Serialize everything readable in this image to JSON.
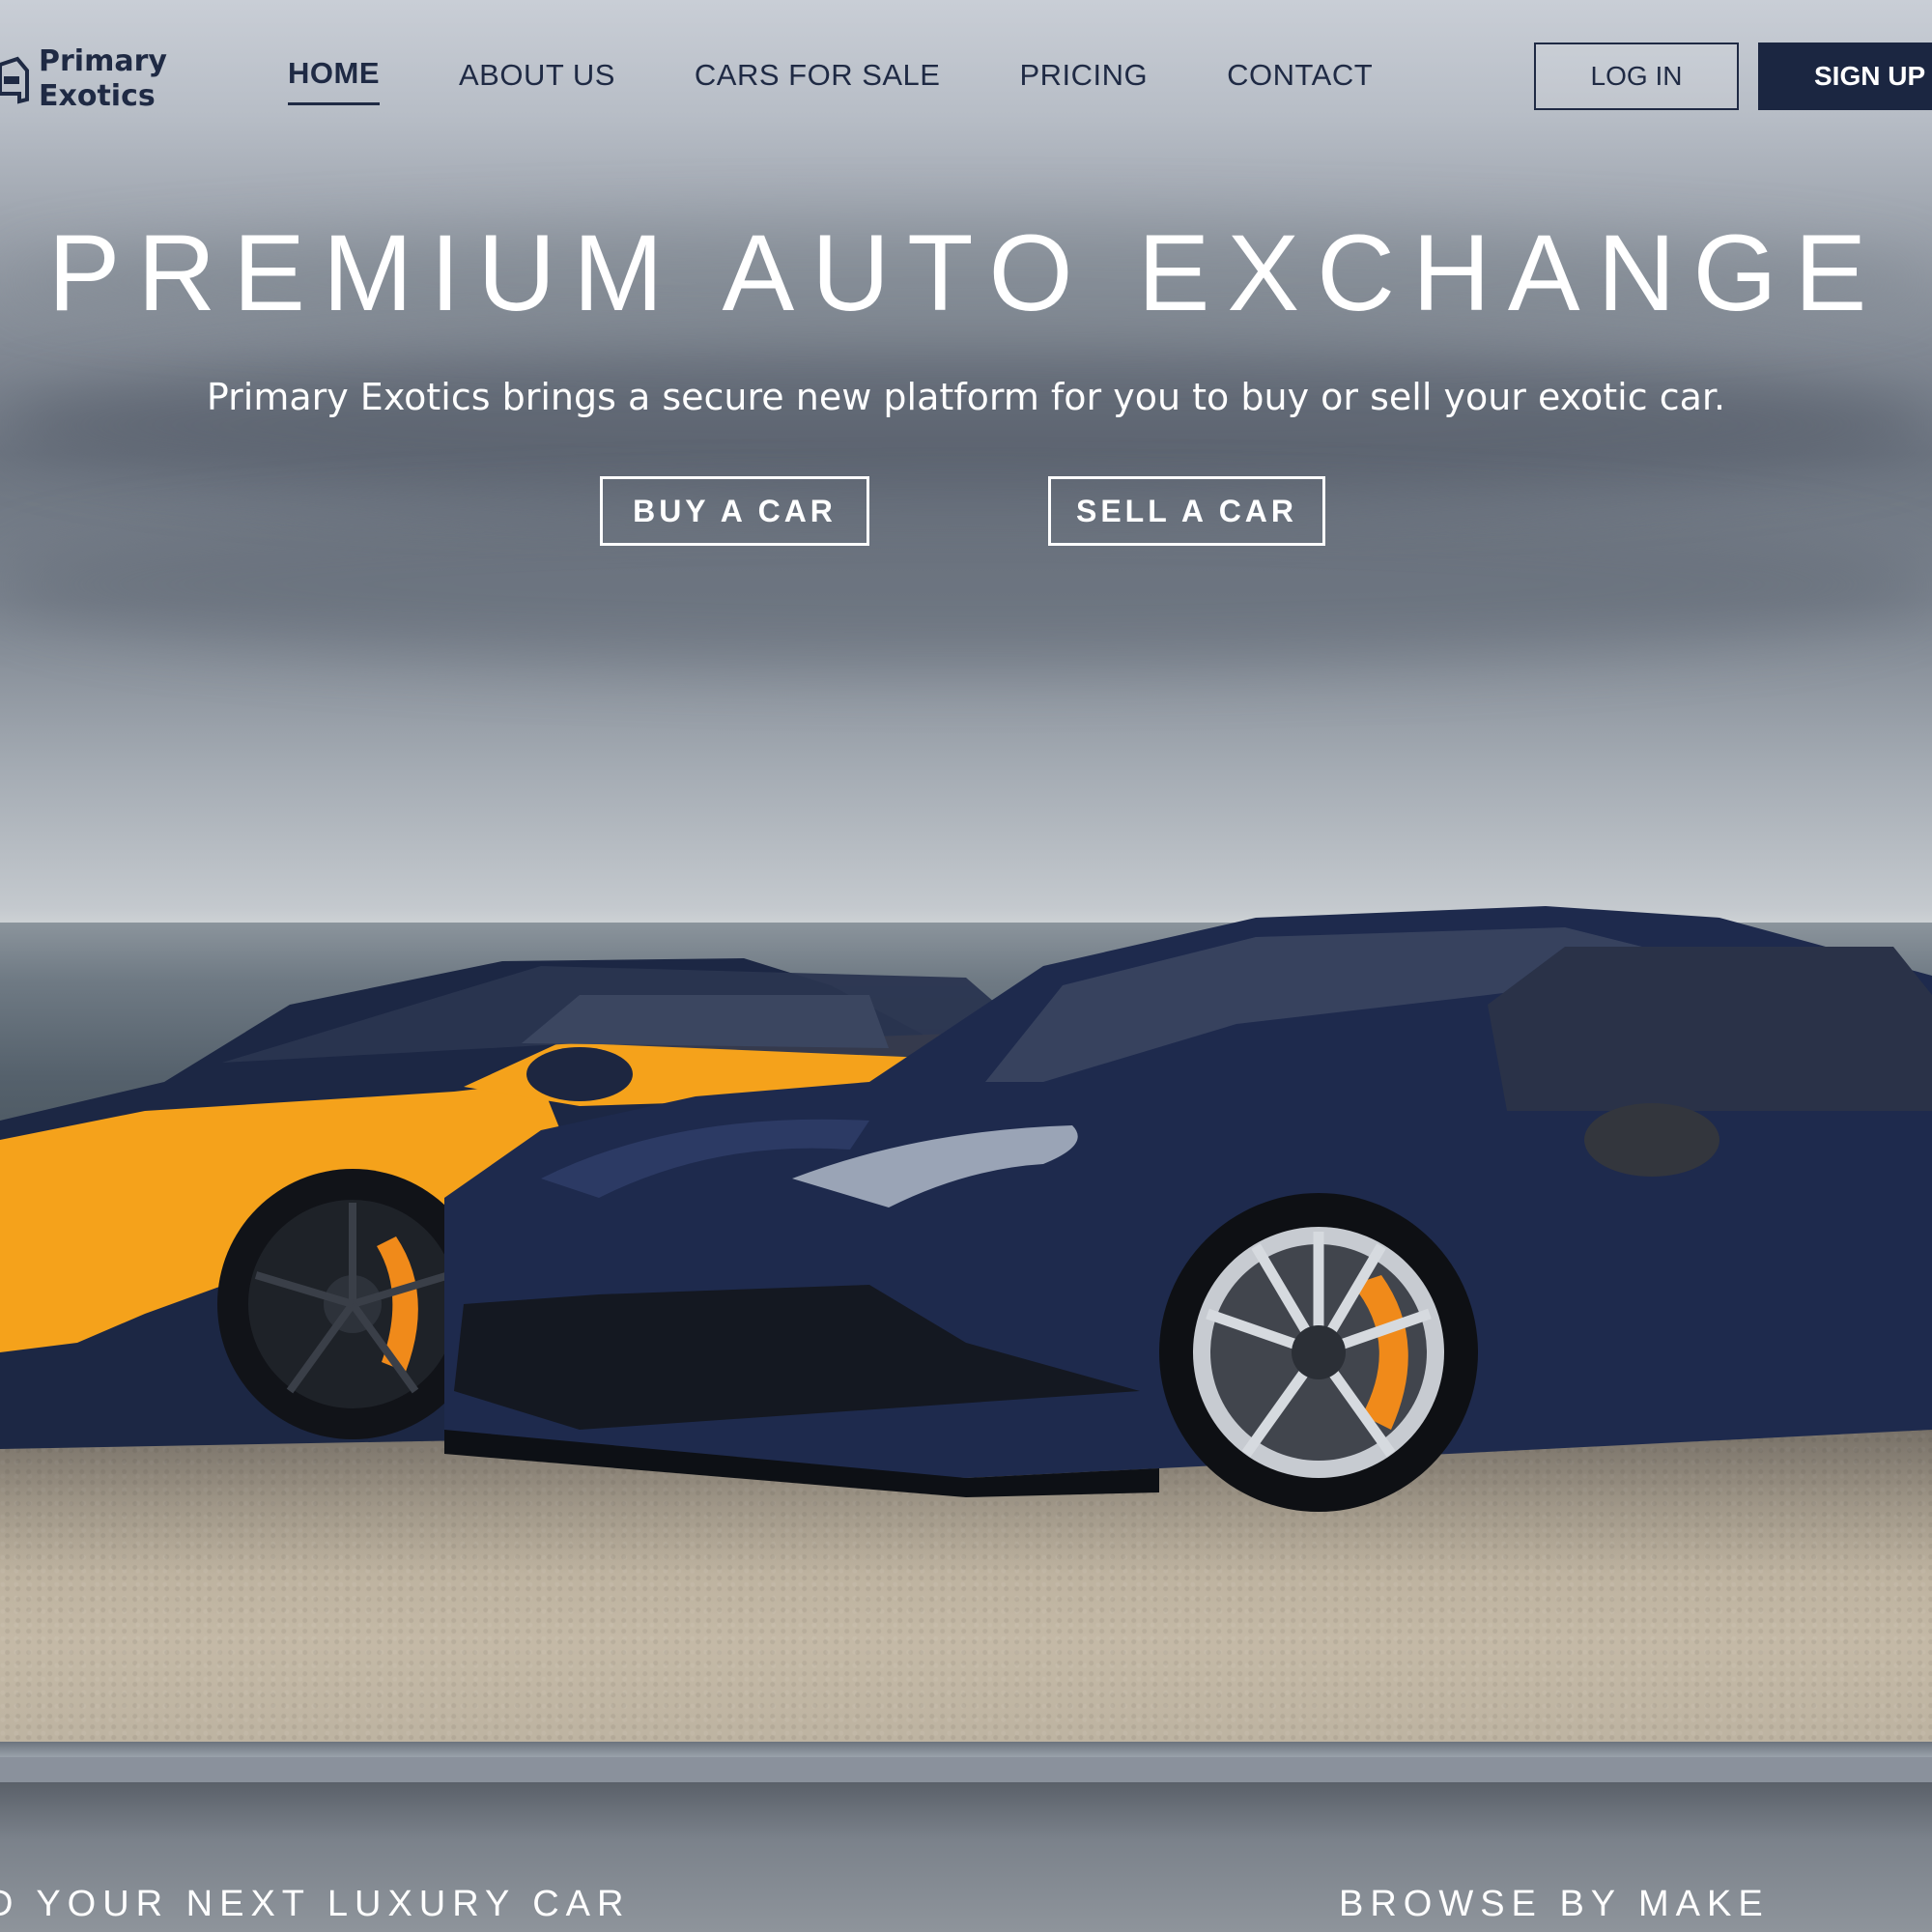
{
  "brand": {
    "name_line1": "Primary",
    "name_line2": "Exotics"
  },
  "nav": {
    "items": [
      {
        "label": "HOME",
        "active": true
      },
      {
        "label": "ABOUT US",
        "active": false
      },
      {
        "label": "CARS FOR SALE",
        "active": false
      },
      {
        "label": "PRICING",
        "active": false
      },
      {
        "label": "CONTACT",
        "active": false
      }
    ],
    "login_label": "LOG IN",
    "signup_label": "SIGN UP"
  },
  "hero": {
    "title": "PREMIUM AUTO EXCHANGE",
    "subtitle": "Primary Exotics brings a secure new platform for you to buy or sell your exotic car.",
    "buy_label": "BUY A CAR",
    "sell_label": "SELL A CAR"
  },
  "sections": {
    "find_label": "D YOUR NEXT LUXURY CAR",
    "browse_label": "BROWSE BY MAKE"
  },
  "colors": {
    "brand_navy": "#1b2641",
    "text_dark": "#1f2a44",
    "hero_text": "#ffffff",
    "orange_car": "#f5a21b",
    "blue_car": "#1e2a4d"
  },
  "icons": {
    "logo": "car-front-icon"
  }
}
